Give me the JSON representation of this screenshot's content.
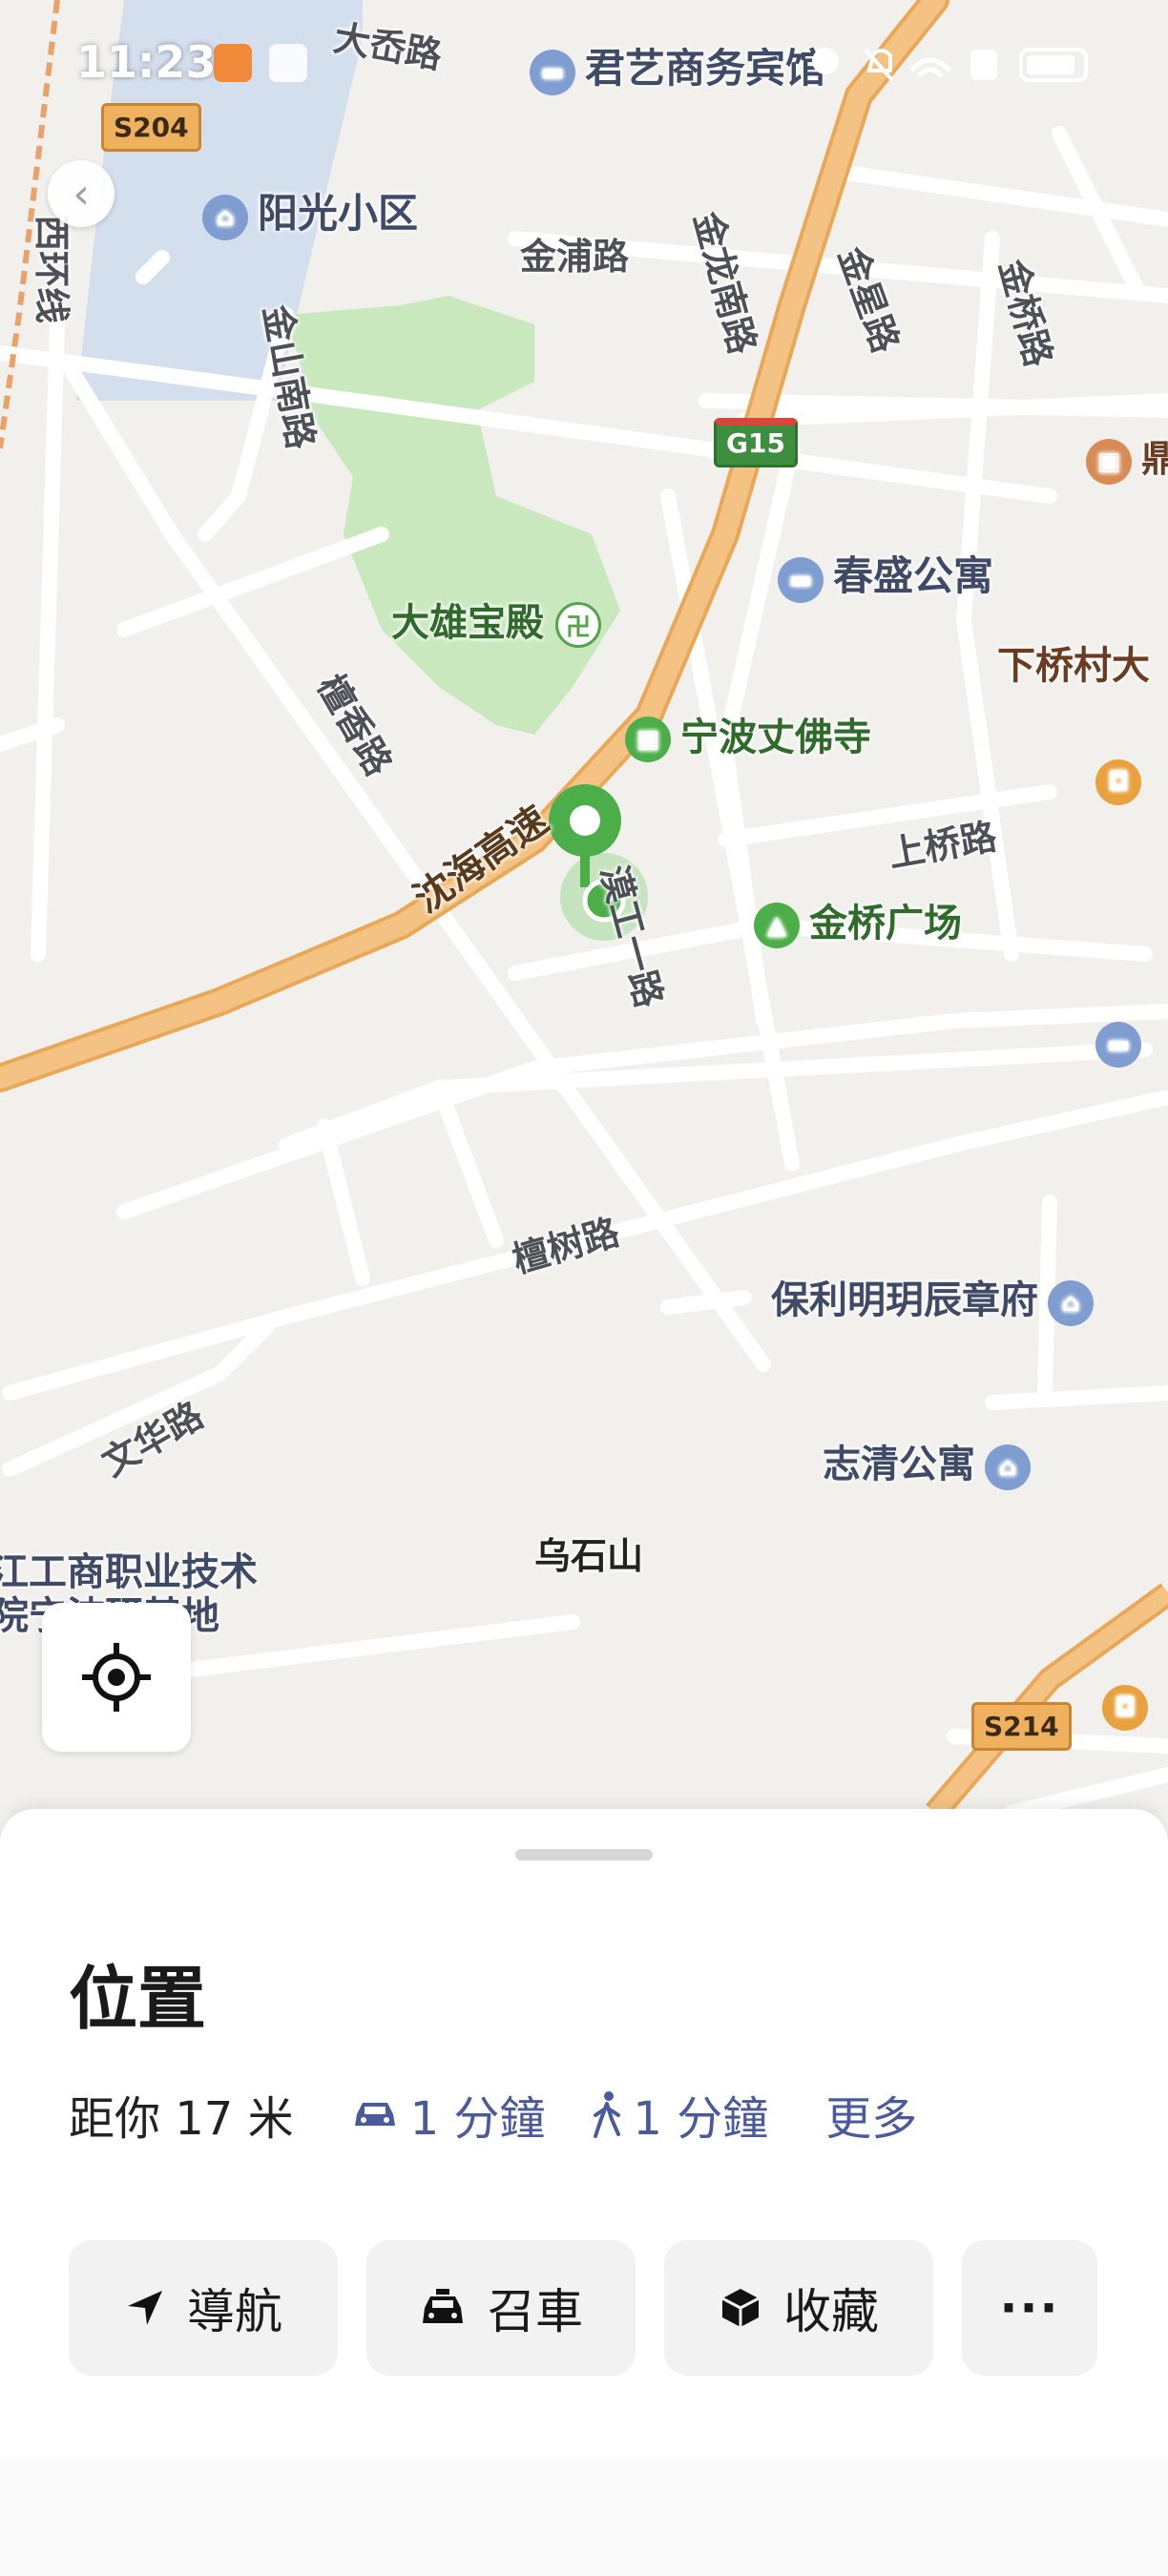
{
  "status_bar": {
    "time": "11:23"
  },
  "map": {
    "roads": [
      "大岙路",
      "金浦路",
      "金龙南路",
      "金星路",
      "金桥路",
      "西环线",
      "金山南路",
      "檀香路",
      "沈海高速",
      "上桥路",
      "漠工一路",
      "檀树路",
      "文华路"
    ],
    "shields": [
      "S204",
      "G15",
      "S214"
    ],
    "pois": {
      "hotel_top": "君艺商务宾馆",
      "residential": "阳光小区",
      "temple_hall": "大雄宝殿",
      "temple": "宁波丈佛寺",
      "apartment": "春盛公寓",
      "plaza": "金桥广场",
      "village": "下桥村大",
      "poly": "保利明玥辰章府",
      "zhiqing": "志清公寓",
      "mountain": "乌石山",
      "school_line1": "江工商职业技术",
      "school_line2": "院宁波研基地",
      "edge_ding": "鼎"
    }
  },
  "sheet": {
    "title": "位置",
    "distance": "距你 17 米",
    "drive_time": "1 分鐘",
    "walk_time": "1 分鐘",
    "more": "更多",
    "actions": {
      "navigate": "導航",
      "ride": "召車",
      "save": "收藏",
      "more_dots": "···"
    }
  }
}
